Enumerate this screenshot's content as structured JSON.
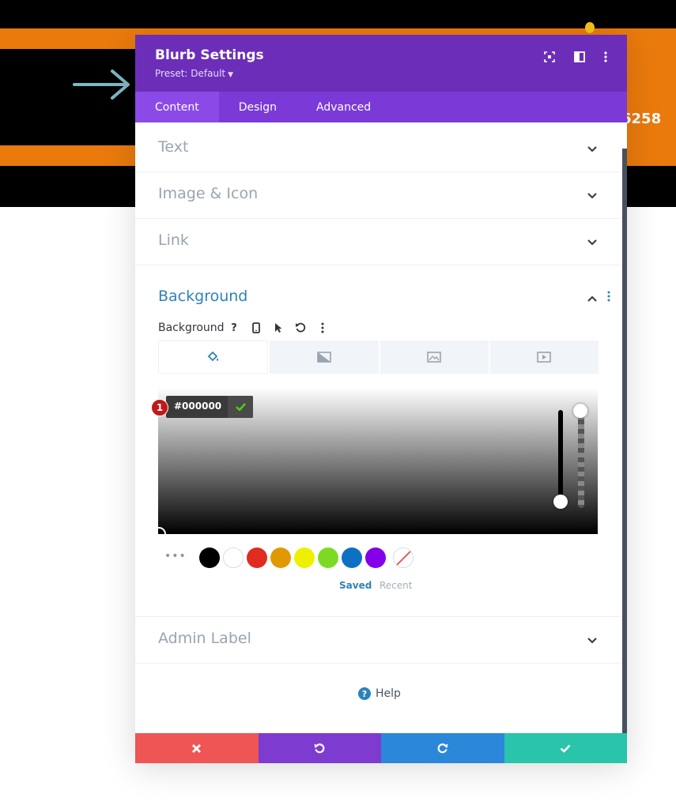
{
  "background_page": {
    "phone_fragment": "258"
  },
  "modal": {
    "title": "Blurb Settings",
    "preset": "Preset: Default",
    "header_icons": [
      "fullscreen-icon",
      "split-view-icon",
      "more-options-icon"
    ]
  },
  "tabs": [
    {
      "label": "Content",
      "active": true
    },
    {
      "label": "Design",
      "active": false
    },
    {
      "label": "Advanced",
      "active": false
    }
  ],
  "sections": {
    "text": "Text",
    "image_icon": "Image & Icon",
    "link": "Link",
    "background": "Background",
    "admin_label": "Admin Label"
  },
  "background_field": {
    "label": "Background",
    "tool_icons": [
      "help-icon",
      "mobile-icon",
      "cursor-icon",
      "reset-icon",
      "more-icon"
    ],
    "type_tabs": [
      "color-icon",
      "gradient-icon",
      "image-icon",
      "video-icon"
    ],
    "hex_value": "#000000",
    "badge_number": "1",
    "swatch_colors": [
      "#000000",
      "#ffffff",
      "#e02b20",
      "#e09900",
      "#edf000",
      "#7cda24",
      "#0c71c3",
      "#8300e9"
    ],
    "saved_label": "Saved",
    "recent_label": "Recent"
  },
  "help_label": "Help",
  "footer": {
    "colors": {
      "cancel": "#ef5555",
      "undo": "#7e3bd0",
      "redo": "#2b87da",
      "save": "#29c4a9"
    }
  },
  "colors": {
    "header": "#6c2eb9",
    "tabs_bar": "#7b3ad7",
    "accent_blue": "#2f82b8",
    "page_orange": "#ea7a0c"
  }
}
